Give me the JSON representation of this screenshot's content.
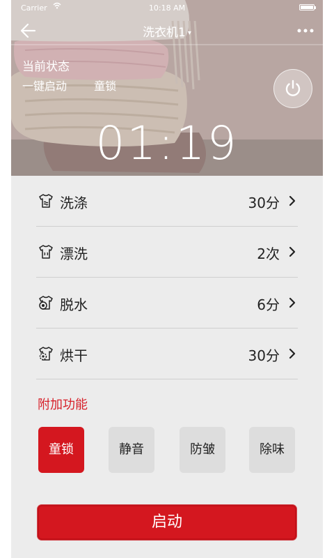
{
  "statusbar": {
    "carrier": "Carrier",
    "time": "10:18 AM"
  },
  "navbar": {
    "title": "洗衣机1",
    "caret": "▾"
  },
  "hero": {
    "status_label": "当前状态",
    "modes": [
      "一键启动",
      "童锁"
    ],
    "timer": "01:19"
  },
  "settings": [
    {
      "label": "洗涤",
      "value": "30分",
      "icon": "wash-shirt-icon"
    },
    {
      "label": "漂洗",
      "value": "2次",
      "icon": "rinse-shirt-icon"
    },
    {
      "label": "脱水",
      "value": "6分",
      "icon": "spin-shirt-icon"
    },
    {
      "label": "烘干",
      "value": "30分",
      "icon": "dry-shirt-icon"
    }
  ],
  "extra": {
    "title": "附加功能",
    "functions": [
      {
        "label": "童锁",
        "active": true
      },
      {
        "label": "静音",
        "active": false
      },
      {
        "label": "防皱",
        "active": false
      },
      {
        "label": "除味",
        "active": false
      }
    ]
  },
  "start_label": "启动",
  "colors": {
    "accent": "#d4171f",
    "list_bg": "#ececec",
    "button_bg": "#dddddd"
  }
}
